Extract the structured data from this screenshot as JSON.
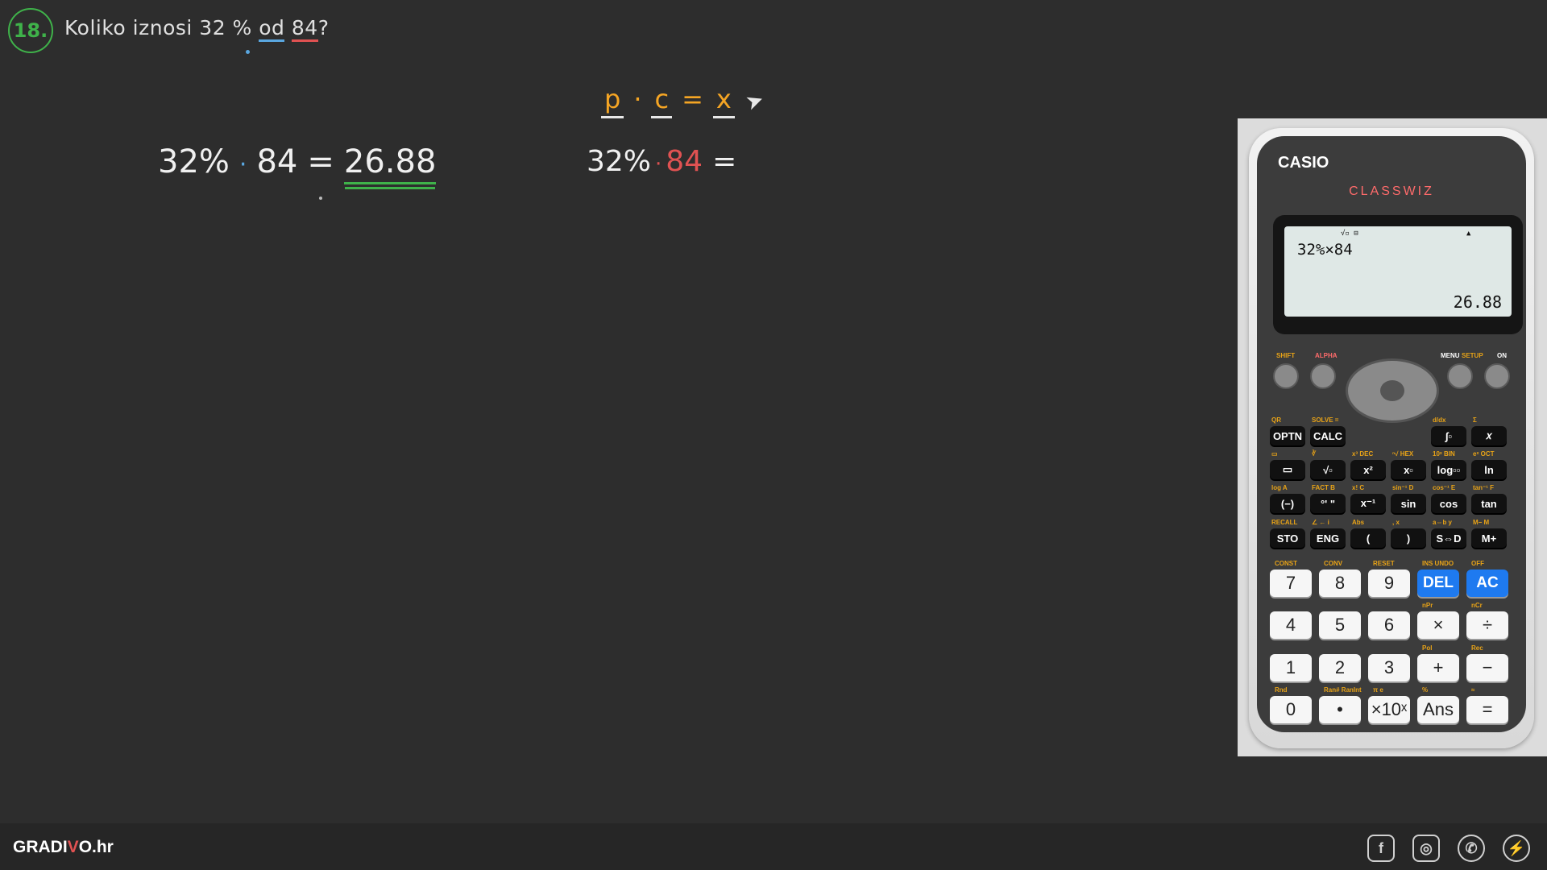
{
  "header": {
    "task_number": "18.",
    "question_prefix": "Koliko iznosi 32 % ",
    "question_of": "od",
    "question_space": " ",
    "question_number": "84",
    "question_mark": "?"
  },
  "board": {
    "left_eq": {
      "percent": "32%",
      "dot": "·",
      "number": "84",
      "equals": "=",
      "result": "26.88"
    },
    "formula": {
      "p": "p",
      "dot": "·",
      "c": "c",
      "equals": "=",
      "x": "x"
    },
    "right_eq": {
      "percent": "32%",
      "dot": "·",
      "number": "84",
      "equals": "="
    }
  },
  "calculator": {
    "brand": "CASIO",
    "model": "CLASSWIZ",
    "screen": {
      "indicators": "√▫ ⊟",
      "up_arrow": "▲",
      "expression": "32%×84",
      "result": "26.88"
    },
    "top_labels": {
      "shift": "SHIFT",
      "alpha": "ALPHA",
      "menu": "MENU",
      "setup": "SETUP",
      "on": "ON"
    },
    "fn_rows": [
      [
        {
          "label": "OPTN",
          "sub": "QR"
        },
        {
          "label": "CALC",
          "sub": "SOLVE ="
        },
        {
          "label": "∫▫",
          "sub": "d/dx"
        },
        {
          "label": "𝑥",
          "sub": "Σ"
        }
      ],
      [
        {
          "label": "▭",
          "sub": "▭"
        },
        {
          "label": "√▫",
          "sub": "∛"
        },
        {
          "label": "x²",
          "sub": "x³ DEC"
        },
        {
          "label": "x▫",
          "sub": "ⁿ√ HEX"
        },
        {
          "label": "log▫▫",
          "sub": "10ˣ BIN"
        },
        {
          "label": "ln",
          "sub": "eˣ OCT"
        }
      ],
      [
        {
          "label": "(−)",
          "sub": "log A"
        },
        {
          "label": "°' \"",
          "sub": "FACT B"
        },
        {
          "label": "x⁻¹",
          "sub": "x! C"
        },
        {
          "label": "sin",
          "sub": "sin⁻¹ D"
        },
        {
          "label": "cos",
          "sub": "cos⁻¹ E"
        },
        {
          "label": "tan",
          "sub": "tan⁻¹ F"
        }
      ],
      [
        {
          "label": "STO",
          "sub": "RECALL"
        },
        {
          "label": "ENG",
          "sub": "∠ ← i"
        },
        {
          "label": "(",
          "sub": "Abs"
        },
        {
          "label": ")",
          "sub": ", x"
        },
        {
          "label": "S⇔D",
          "sub": "a⇔b y"
        },
        {
          "label": "M+",
          "sub": "M− M"
        }
      ]
    ],
    "num_rows": [
      [
        {
          "label": "7",
          "sub": "CONST"
        },
        {
          "label": "8",
          "sub": "CONV"
        },
        {
          "label": "9",
          "sub": "RESET"
        },
        {
          "label": "DEL",
          "sub": "INS UNDO"
        },
        {
          "label": "AC",
          "sub": "OFF"
        }
      ],
      [
        {
          "label": "4",
          "sub": ""
        },
        {
          "label": "5",
          "sub": ""
        },
        {
          "label": "6",
          "sub": ""
        },
        {
          "label": "×",
          "sub": "nPr"
        },
        {
          "label": "÷",
          "sub": "nCr"
        }
      ],
      [
        {
          "label": "1",
          "sub": ""
        },
        {
          "label": "2",
          "sub": ""
        },
        {
          "label": "3",
          "sub": ""
        },
        {
          "label": "+",
          "sub": "Pol"
        },
        {
          "label": "−",
          "sub": "Rec"
        }
      ],
      [
        {
          "label": "0",
          "sub": "Rnd"
        },
        {
          "label": "•",
          "sub": "Ran# RanInt"
        },
        {
          "label": "×10ˣ",
          "sub": "π e"
        },
        {
          "label": "Ans",
          "sub": "%"
        },
        {
          "label": "=",
          "sub": "≈"
        }
      ]
    ]
  },
  "footer": {
    "logo_prefix": "GRADI",
    "logo_v": "V",
    "logo_suffix": "O.hr",
    "social": [
      {
        "icon": "facebook-icon",
        "glyph": "f"
      },
      {
        "icon": "instagram-icon",
        "glyph": "◎"
      },
      {
        "icon": "whatsapp-icon",
        "glyph": "✆"
      },
      {
        "icon": "messenger-icon",
        "glyph": "⚡"
      }
    ]
  }
}
